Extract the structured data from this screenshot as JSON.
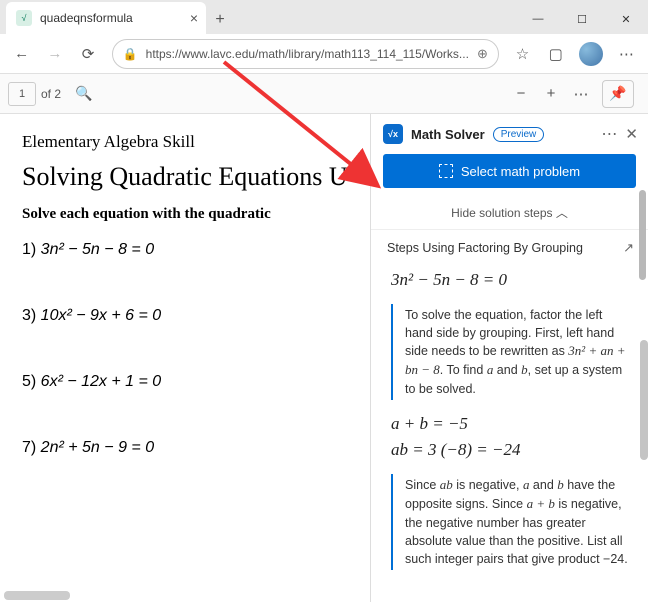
{
  "tab": {
    "title": "quadeqnsformula",
    "favicon_letter": "√"
  },
  "toolbar": {
    "url": "https://www.lavc.edu/math/library/math113_114_115/Works..."
  },
  "pdfbar": {
    "page": "1",
    "of_label": "of 2"
  },
  "doc": {
    "subhead": "Elementary Algebra Skill",
    "head": "Solving Quadratic Equations U",
    "instr": "Solve each equation with the quadratic",
    "eq1_label": "1)  ",
    "eq1": "3n² − 5n − 8 = 0",
    "eq3_label": "3)  ",
    "eq3": "10x² − 9x + 6 = 0",
    "eq5_label": "5)  ",
    "eq5": "6x² − 12x + 1 = 0",
    "eq7_label": "7)  ",
    "eq7": "2n² + 5n − 9 = 0"
  },
  "panel": {
    "title": "Math Solver",
    "preview": "Preview",
    "button": "Select math problem",
    "hide": "Hide solution steps  ︿",
    "step_title": "Steps Using Factoring By Grouping",
    "equation": "3n² − 5n − 8 = 0",
    "explain1_a": "To solve the equation, factor the left hand side by grouping. First, left hand side needs to be rewritten as ",
    "explain1_math": "3n² + an + bn − 8",
    "explain1_b": ". To find ",
    "explain1_c": " and ",
    "explain1_d": ", set up a system to be solved.",
    "sys1": "a + b = −5",
    "sys2": "ab = 3 (−8) = −24",
    "explain2_a": "Since ",
    "explain2_b": " is negative, ",
    "explain2_c": " and ",
    "explain2_d": " have the opposite signs. Since ",
    "explain2_e": " is negative, the negative number has greater absolute value than the positive. List all such integer pairs that give product −24."
  }
}
